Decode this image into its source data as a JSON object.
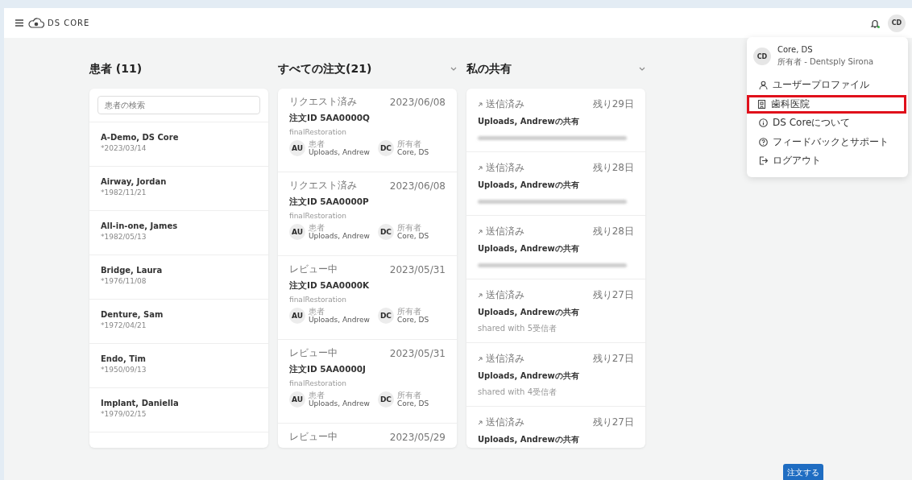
{
  "header": {
    "logo": "DS CORE",
    "avatar": "CD"
  },
  "patients": {
    "title": "患者 (11)",
    "search_placeholder": "患者の検索",
    "rows": [
      {
        "name": "A-Demo, DS Core",
        "birth": "*2023/03/14"
      },
      {
        "name": "Airway, Jordan",
        "birth": "*1982/11/21"
      },
      {
        "name": "All-in-one, James",
        "birth": "*1982/05/13"
      },
      {
        "name": "Bridge, Laura",
        "birth": "*1976/11/08"
      },
      {
        "name": "Denture, Sam",
        "birth": "*1972/04/21"
      },
      {
        "name": "Endo, Tim",
        "birth": "*1950/09/13"
      },
      {
        "name": "Implant, Daniella",
        "birth": "*1979/02/15"
      }
    ]
  },
  "orders": {
    "title": "すべての注文(21)",
    "cards": [
      {
        "status": "リクエスト済み",
        "date": "2023/06/08",
        "id": "注文ID 5AA0000Q",
        "type": "finalRestoration",
        "people": [
          {
            "initials": "AU",
            "role": "患者",
            "name": "Uploads, Andrew"
          },
          {
            "initials": "DC",
            "role": "所有者",
            "name": "Core, DS"
          }
        ]
      },
      {
        "status": "リクエスト済み",
        "date": "2023/06/08",
        "id": "注文ID 5AA0000P",
        "type": "finalRestoration",
        "people": [
          {
            "initials": "AU",
            "role": "患者",
            "name": "Uploads, Andrew"
          },
          {
            "initials": "DC",
            "role": "所有者",
            "name": "Core, DS"
          }
        ]
      },
      {
        "status": "レビュー中",
        "date": "2023/05/31",
        "id": "注文ID 5AA0000K",
        "type": "finalRestoration",
        "people": [
          {
            "initials": "AU",
            "role": "患者",
            "name": "Uploads, Andrew"
          },
          {
            "initials": "DC",
            "role": "所有者",
            "name": "Core, DS"
          }
        ]
      },
      {
        "status": "レビュー中",
        "date": "2023/05/31",
        "id": "注文ID 5AA0000J",
        "type": "finalRestoration",
        "people": [
          {
            "initials": "AU",
            "role": "患者",
            "name": "Uploads, Andrew"
          },
          {
            "initials": "DC",
            "role": "所有者",
            "name": "Core, DS"
          }
        ]
      },
      {
        "status": "レビュー中",
        "date": "2023/05/29"
      }
    ]
  },
  "shares": {
    "title": "私の共有",
    "cards": [
      {
        "status": "送信済み",
        "remaining": "残り29日",
        "title": "Uploads, Andrewの共有",
        "redacted": true
      },
      {
        "status": "送信済み",
        "remaining": "残り28日",
        "title": "Uploads, Andrewの共有",
        "redacted": true
      },
      {
        "status": "送信済み",
        "remaining": "残り28日",
        "title": "Uploads, Andrewの共有",
        "redacted": true
      },
      {
        "status": "送信済み",
        "remaining": "残り27日",
        "title": "Uploads, Andrewの共有",
        "redacted": false,
        "detail": "shared with 5受信者"
      },
      {
        "status": "送信済み",
        "remaining": "残り27日",
        "title": "Uploads, Andrewの共有",
        "redacted": false,
        "detail": "shared with 4受信者"
      },
      {
        "status": "送信済み",
        "remaining": "残り27日",
        "title": "Uploads, Andrewの共有"
      }
    ]
  },
  "user_menu": {
    "initials": "CD",
    "name": "Core, DS",
    "subtitle": "所有者 - Dentsply Sirona",
    "items": [
      {
        "kind": "user",
        "label": "ユーザープロファイル",
        "highlighted": false
      },
      {
        "kind": "clinic",
        "label": "歯科医院",
        "highlighted": true
      },
      {
        "kind": "info",
        "label": "DS Coreについて",
        "highlighted": false
      },
      {
        "kind": "help",
        "label": "フィードバックとサポート",
        "highlighted": false
      },
      {
        "kind": "logout",
        "label": "ログアウト",
        "highlighted": false
      }
    ]
  },
  "order_button": "注文する"
}
